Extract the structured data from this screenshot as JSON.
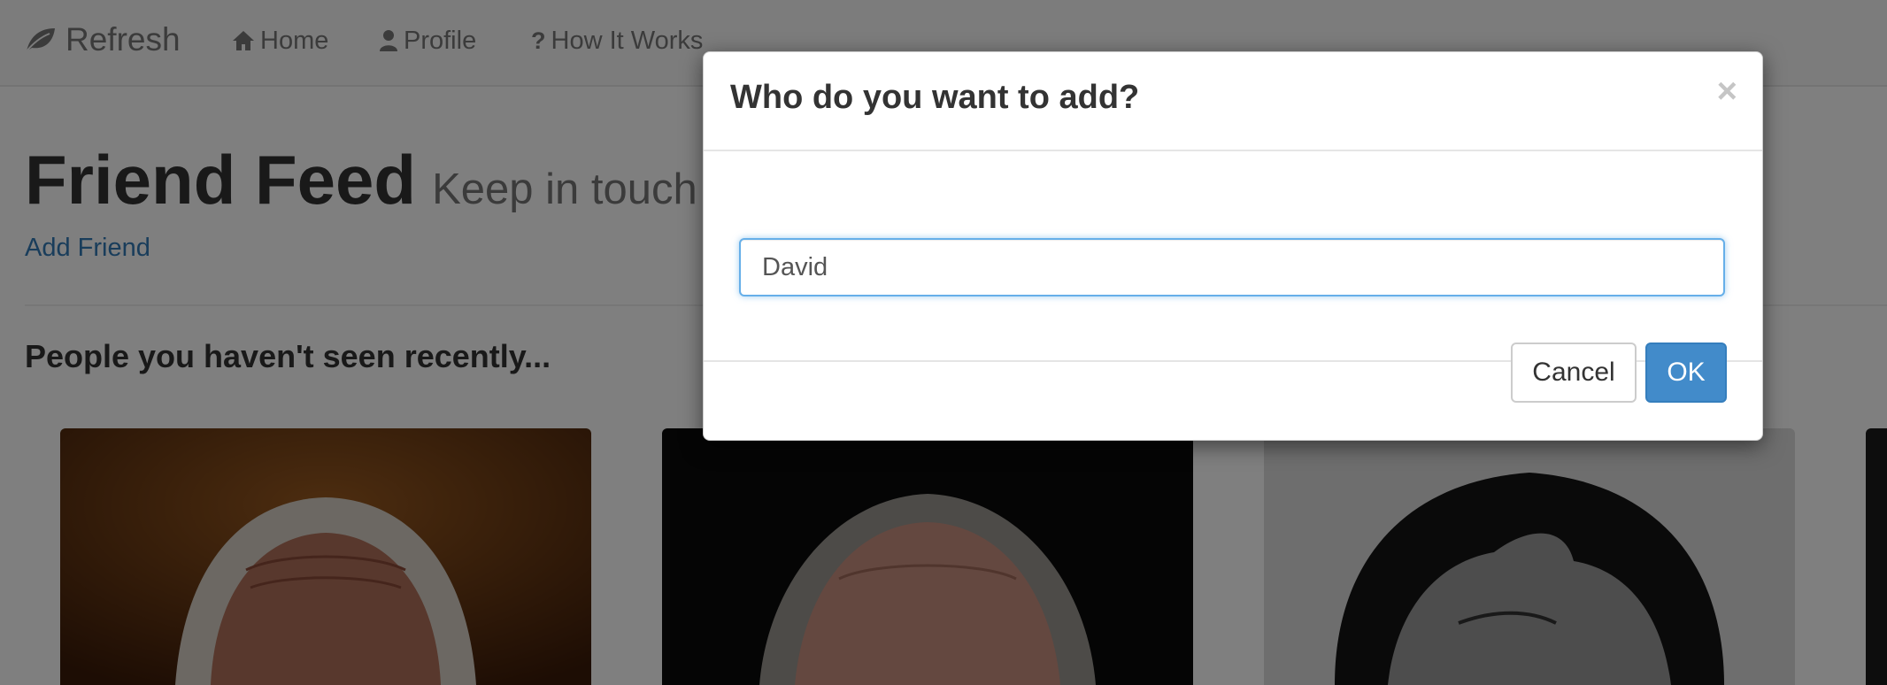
{
  "navbar": {
    "brand": "Refresh",
    "items": [
      {
        "label": "Home",
        "icon": "home-icon"
      },
      {
        "label": "Profile",
        "icon": "user-icon"
      },
      {
        "label": "How It Works",
        "icon": "question-icon"
      }
    ]
  },
  "page": {
    "title": "Friend Feed",
    "subtitle": "Keep in touch",
    "add_friend_link": "Add Friend",
    "section_heading": "People you haven't seen recently..."
  },
  "modal": {
    "title": "Who do you want to add?",
    "close_symbol": "×",
    "input_value": "David",
    "cancel_label": "Cancel",
    "ok_label": "OK"
  },
  "colors": {
    "link": "#337ab7",
    "primary_button": "#428bca",
    "input_focus_border": "#66afe9"
  }
}
